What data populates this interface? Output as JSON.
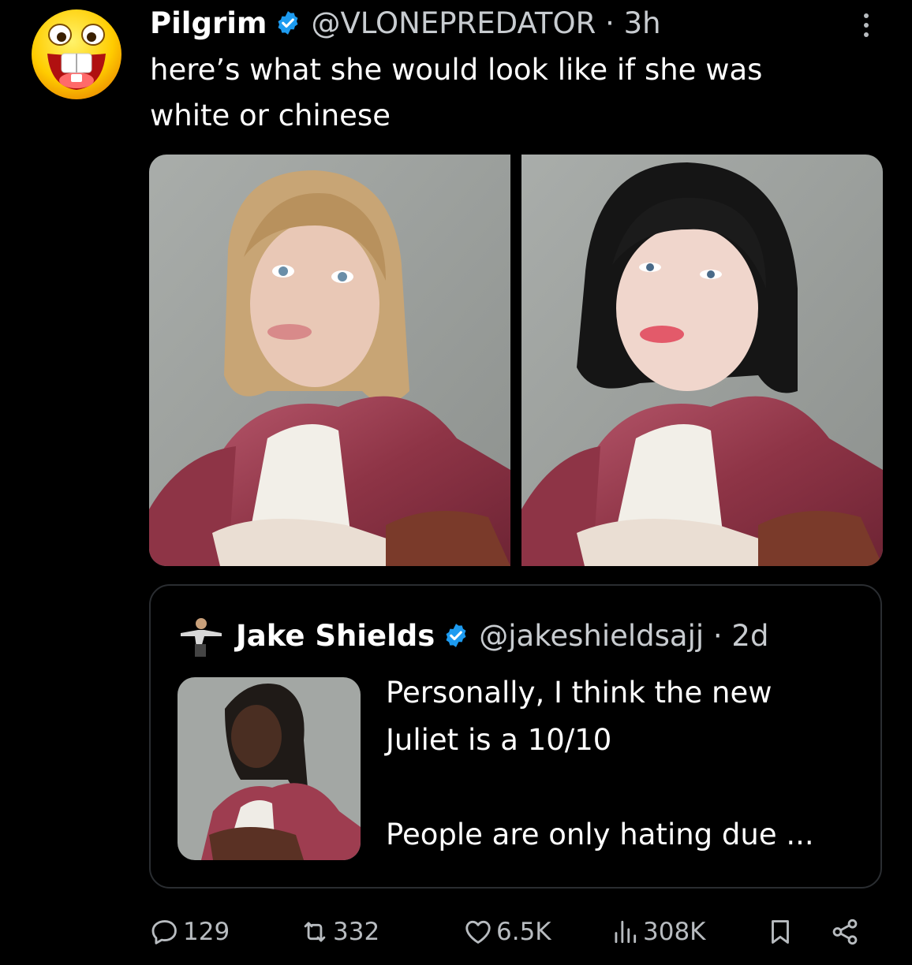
{
  "tweet": {
    "avatar_icon": "laughing-emoji-icon",
    "display_name": "Pilgrim",
    "handle_time": "@VLONEPREDATOR · 3h",
    "text_line1": "here’s what she would look like if she was",
    "text_line2": "white or chinese",
    "media": [
      {
        "subject": "blonde-portrait-image"
      },
      {
        "subject": "black-hair-portrait-image"
      }
    ]
  },
  "quote": {
    "display_name": "Jake Shields",
    "handle_time": "@jakeshieldsajj · 2d",
    "text_line1": "Personally, I think the new",
    "text_line2": "Juliet is a 10/10",
    "text_line3": "People are only hating due ..."
  },
  "actions": {
    "replies": "129",
    "reposts": "332",
    "likes": "6.5K",
    "views": "308K"
  },
  "colors": {
    "background": "#000000",
    "text": "#ffffff",
    "muted": "#b8bcc0",
    "verified": "#1d9bf0",
    "jacket": "#9a3a4c"
  }
}
